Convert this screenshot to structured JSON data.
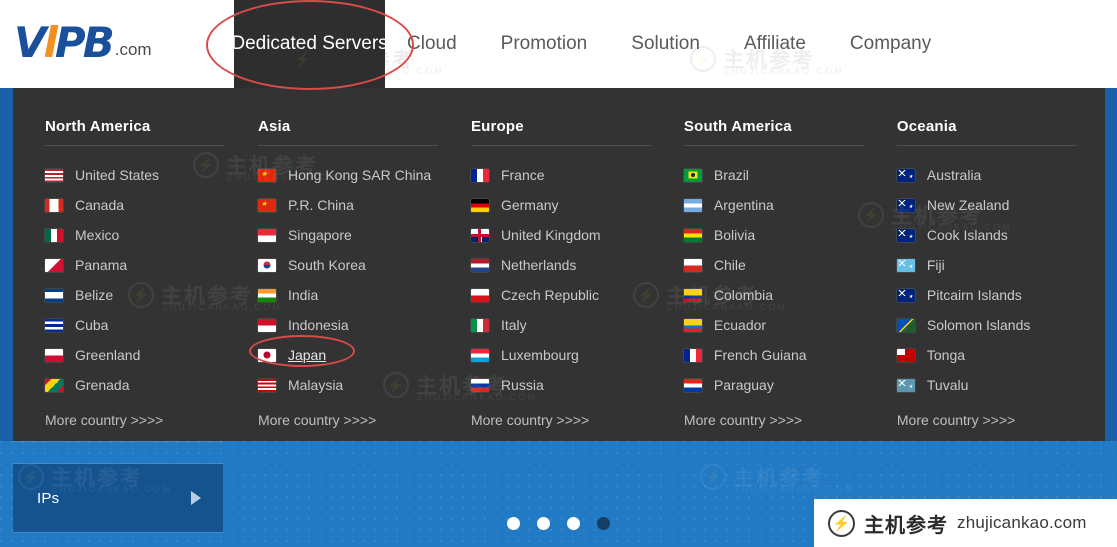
{
  "brand": {
    "logo_text": "VPB",
    "logo_suffix": ".com"
  },
  "nav": {
    "items": [
      {
        "label": "Dedicated Servers",
        "active": true
      },
      {
        "label": "Cloud",
        "active": false
      },
      {
        "label": "Promotion",
        "active": false
      },
      {
        "label": "Solution",
        "active": false
      },
      {
        "label": "Affiliate",
        "active": false
      },
      {
        "label": "Company",
        "active": false
      }
    ]
  },
  "mega_menu": {
    "more_label": "More country >>>>",
    "columns": [
      {
        "title": "North America",
        "countries": [
          {
            "name": "United States",
            "flag": "us",
            "selected": false
          },
          {
            "name": "Canada",
            "flag": "ca",
            "selected": false
          },
          {
            "name": "Mexico",
            "flag": "mx",
            "selected": false
          },
          {
            "name": "Panama",
            "flag": "pa",
            "selected": false
          },
          {
            "name": "Belize",
            "flag": "bz",
            "selected": false
          },
          {
            "name": "Cuba",
            "flag": "cu",
            "selected": false
          },
          {
            "name": "Greenland",
            "flag": "gl",
            "selected": false
          },
          {
            "name": "Grenada",
            "flag": "gd",
            "selected": false
          }
        ]
      },
      {
        "title": "Asia",
        "countries": [
          {
            "name": "Hong Kong SAR China",
            "flag": "hk",
            "selected": false
          },
          {
            "name": "P.R. China",
            "flag": "cn",
            "selected": false
          },
          {
            "name": "Singapore",
            "flag": "sg",
            "selected": false
          },
          {
            "name": "South Korea",
            "flag": "kr",
            "selected": false
          },
          {
            "name": "India",
            "flag": "in",
            "selected": false
          },
          {
            "name": "Indonesia",
            "flag": "id",
            "selected": false
          },
          {
            "name": "Japan",
            "flag": "jp",
            "selected": true
          },
          {
            "name": "Malaysia",
            "flag": "my",
            "selected": false
          }
        ]
      },
      {
        "title": "Europe",
        "countries": [
          {
            "name": "France",
            "flag": "fr",
            "selected": false
          },
          {
            "name": "Germany",
            "flag": "de",
            "selected": false
          },
          {
            "name": "United Kingdom",
            "flag": "gb",
            "selected": false
          },
          {
            "name": "Netherlands",
            "flag": "nl",
            "selected": false
          },
          {
            "name": "Czech Republic",
            "flag": "cz",
            "selected": false
          },
          {
            "name": "Italy",
            "flag": "it",
            "selected": false
          },
          {
            "name": "Luxembourg",
            "flag": "lu",
            "selected": false
          },
          {
            "name": "Russia",
            "flag": "ru",
            "selected": false
          }
        ]
      },
      {
        "title": "South America",
        "countries": [
          {
            "name": "Brazil",
            "flag": "br",
            "selected": false
          },
          {
            "name": "Argentina",
            "flag": "ar",
            "selected": false
          },
          {
            "name": "Bolivia",
            "flag": "bo",
            "selected": false
          },
          {
            "name": "Chile",
            "flag": "cl",
            "selected": false
          },
          {
            "name": "Colombia",
            "flag": "co",
            "selected": false
          },
          {
            "name": "Ecuador",
            "flag": "ec",
            "selected": false
          },
          {
            "name": "French Guiana",
            "flag": "gf",
            "selected": false
          },
          {
            "name": "Paraguay",
            "flag": "py",
            "selected": false
          }
        ]
      },
      {
        "title": "Oceania",
        "countries": [
          {
            "name": "Australia",
            "flag": "au",
            "selected": false
          },
          {
            "name": "New Zealand",
            "flag": "nz",
            "selected": false
          },
          {
            "name": "Cook Islands",
            "flag": "ck",
            "selected": false
          },
          {
            "name": "Fiji",
            "flag": "fj",
            "selected": false
          },
          {
            "name": "Pitcairn Islands",
            "flag": "pn",
            "selected": false
          },
          {
            "name": "Solomon Islands",
            "flag": "sb",
            "selected": false
          },
          {
            "name": "Tonga",
            "flag": "to",
            "selected": false
          },
          {
            "name": "Tuvalu",
            "flag": "tv",
            "selected": false
          }
        ]
      }
    ]
  },
  "hero": {
    "sidebar_item": "IPs",
    "carousel_dots": 4,
    "carousel_active_index": 3
  },
  "annotations": [
    {
      "name": "nav-dedicated-servers-highlight",
      "color": "#d84b48"
    },
    {
      "name": "japan-highlight",
      "color": "#d84b48"
    }
  ],
  "watermark": {
    "cn": "主机参考",
    "en": "ZHUJICANKAO.COM",
    "bolt": "⚡"
  },
  "badge": {
    "cn": "主机参考",
    "domain": "zhujicankao.com",
    "bolt": "⚡"
  }
}
